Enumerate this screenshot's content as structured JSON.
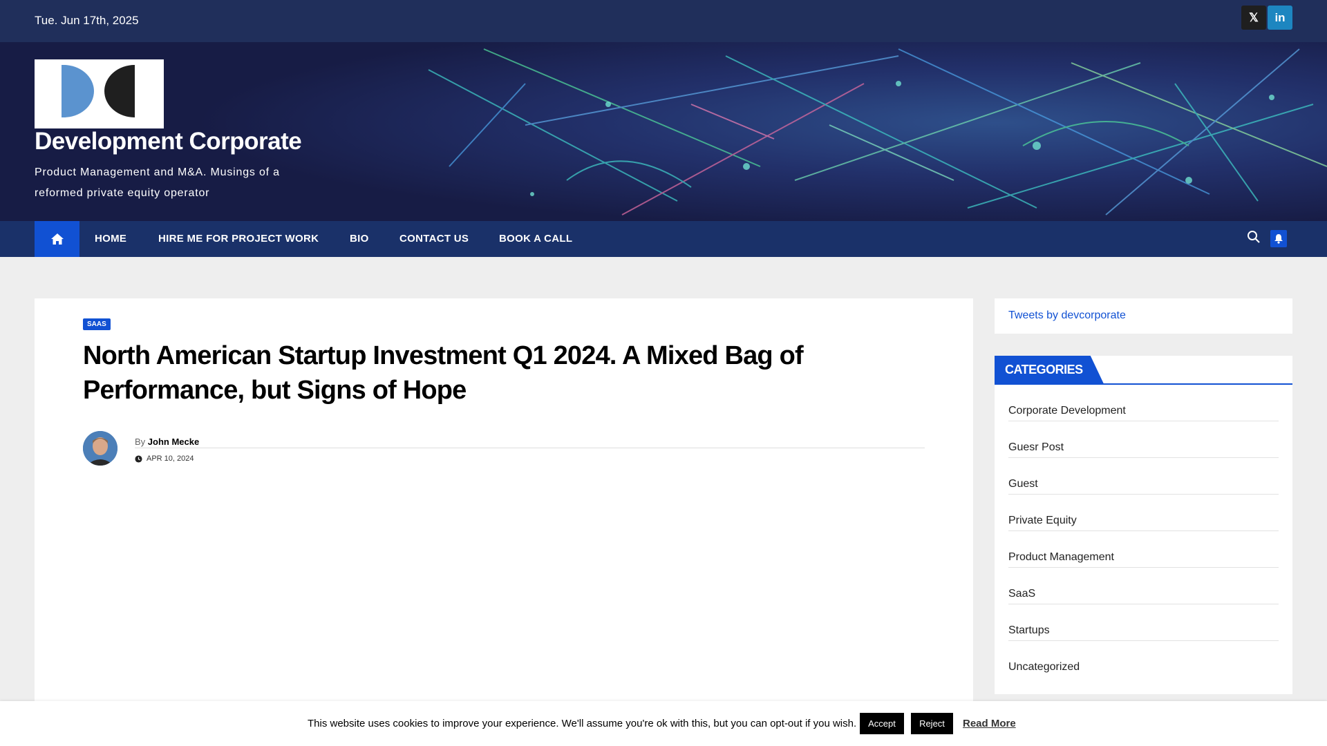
{
  "topbar": {
    "date": "Tue. Jun 17th, 2025",
    "social": [
      {
        "icon": "x-twitter-icon",
        "glyph": "𝕏"
      },
      {
        "icon": "linkedin-icon",
        "glyph": "in"
      }
    ]
  },
  "header": {
    "title": "Development Corporate",
    "description": "Product Management and M&A. Musings of a reformed private equity operator"
  },
  "nav": {
    "items": [
      "HOME",
      "HIRE ME FOR PROJECT WORK",
      "BIO",
      "CONTACT US",
      "BOOK A CALL"
    ]
  },
  "post": {
    "tag": "SAAS",
    "title": "North American Startup Investment Q1 2024. A Mixed Bag of Performance, but Signs of Hope",
    "by": "By",
    "author": "John Mecke",
    "date": "APR 10, 2024"
  },
  "sidebar": {
    "tweets_link": "Tweets by devcorporate",
    "categories_title": "CATEGORIES",
    "categories": [
      "Corporate Development",
      "Guesr Post",
      "Guest",
      "Private Equity",
      "Product Management",
      "SaaS",
      "Startups",
      "Uncategorized"
    ]
  },
  "cookie": {
    "message": "This website uses cookies to improve your experience. We'll assume you're ok with this, but you can opt-out if you wish.",
    "accept": "Accept",
    "reject": "Reject",
    "read_more": "Read More"
  },
  "colors": {
    "topbar": "#202f5b",
    "nav": "#1a3169",
    "accent": "#1151d3"
  }
}
